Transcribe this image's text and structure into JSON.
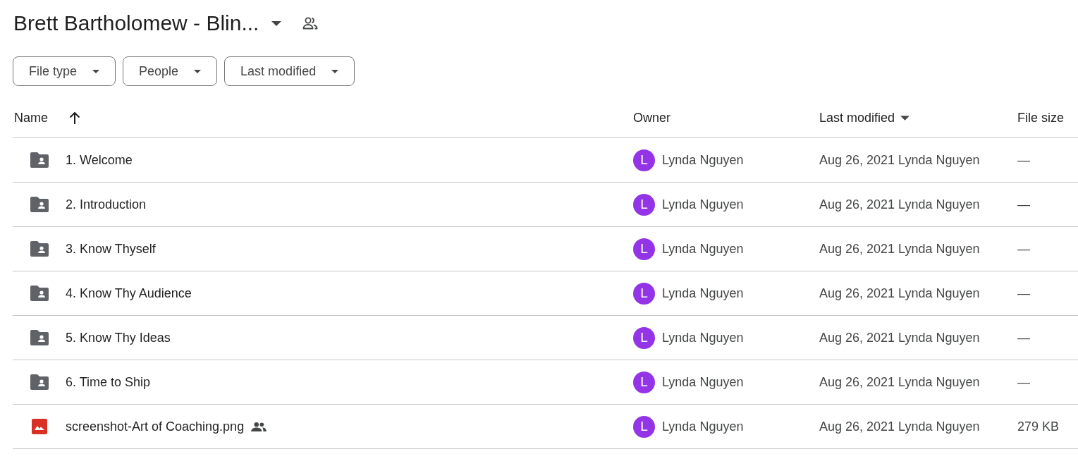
{
  "header": {
    "title": "Brett Bartholomew - Blin...",
    "shared": true
  },
  "filters": [
    {
      "label": "File type"
    },
    {
      "label": "People"
    },
    {
      "label": "Last modified"
    }
  ],
  "table": {
    "columns": [
      {
        "label": "Name",
        "kind": "sort-asc"
      },
      {
        "label": "Owner",
        "kind": "plain"
      },
      {
        "label": "Last modified",
        "kind": "dropdown"
      },
      {
        "label": "File size",
        "kind": "plain"
      }
    ],
    "rows": [
      {
        "kind": "folder",
        "name": "1. Welcome",
        "shared": false,
        "owner_initial": "L",
        "owner": "Lynda Nguyen",
        "modified": "Aug 26, 2021 Lynda Nguyen",
        "size": "—"
      },
      {
        "kind": "folder",
        "name": "2. Introduction",
        "shared": false,
        "owner_initial": "L",
        "owner": "Lynda Nguyen",
        "modified": "Aug 26, 2021 Lynda Nguyen",
        "size": "—"
      },
      {
        "kind": "folder",
        "name": "3. Know Thyself",
        "shared": false,
        "owner_initial": "L",
        "owner": "Lynda Nguyen",
        "modified": "Aug 26, 2021 Lynda Nguyen",
        "size": "—"
      },
      {
        "kind": "folder",
        "name": "4. Know Thy Audience",
        "shared": false,
        "owner_initial": "L",
        "owner": "Lynda Nguyen",
        "modified": "Aug 26, 2021 Lynda Nguyen",
        "size": "—"
      },
      {
        "kind": "folder",
        "name": "5. Know Thy Ideas",
        "shared": false,
        "owner_initial": "L",
        "owner": "Lynda Nguyen",
        "modified": "Aug 26, 2021 Lynda Nguyen",
        "size": "—"
      },
      {
        "kind": "folder",
        "name": "6. Time to Ship",
        "shared": false,
        "owner_initial": "L",
        "owner": "Lynda Nguyen",
        "modified": "Aug 26, 2021 Lynda Nguyen",
        "size": "—"
      },
      {
        "kind": "image",
        "name": "screenshot-Art of Coaching.png",
        "shared": true,
        "owner_initial": "L",
        "owner": "Lynda Nguyen",
        "modified": "Aug 26, 2021 Lynda Nguyen",
        "size": "279 KB"
      }
    ]
  }
}
